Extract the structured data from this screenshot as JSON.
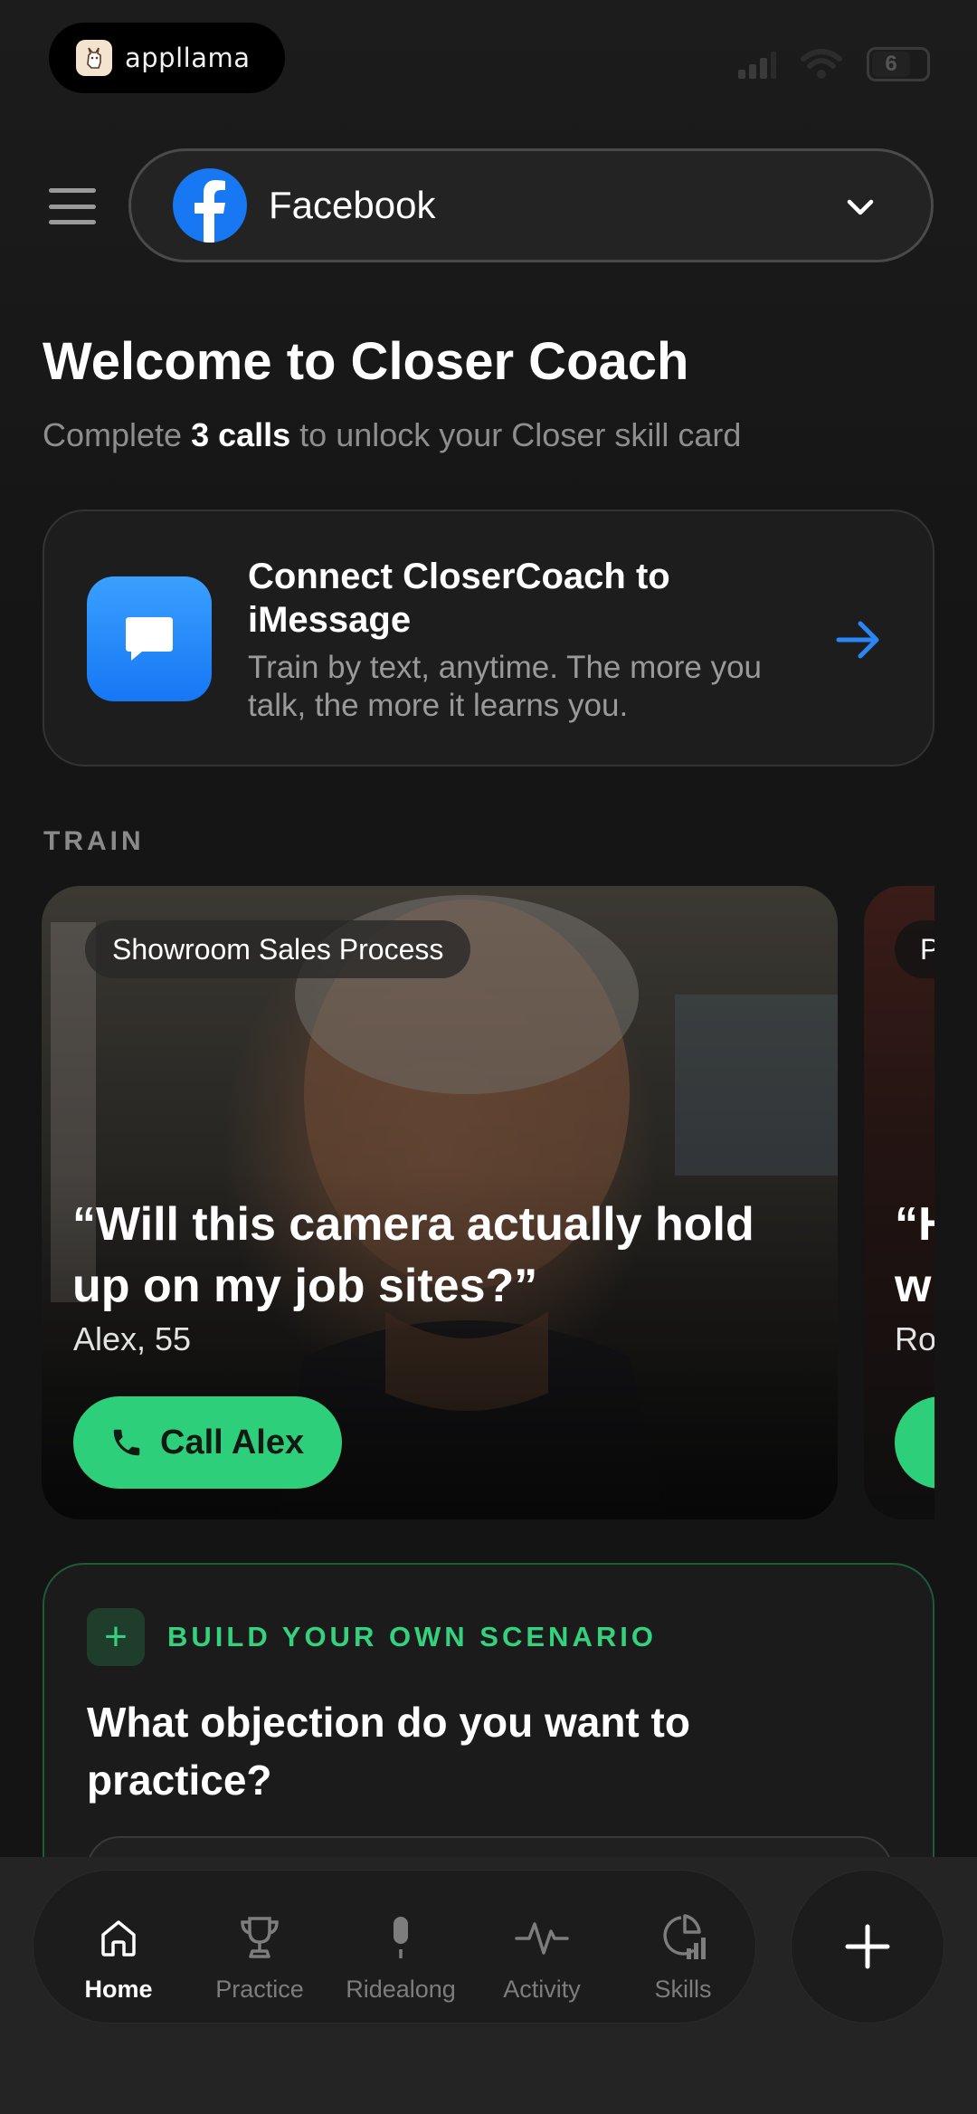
{
  "status_bar": {
    "app_name": "appllama",
    "battery_text": "6"
  },
  "header": {
    "account_name": "Facebook"
  },
  "welcome": {
    "title": "Welcome to Closer Coach",
    "sub_prefix": "Complete ",
    "sub_bold": "3 calls",
    "sub_suffix": " to unlock your Closer skill card"
  },
  "connect_card": {
    "title": "Connect CloserCoach to iMessage",
    "description": "Train by text, anytime. The more you talk, the more it learns you."
  },
  "train": {
    "section_label": "TRAIN",
    "cards": [
      {
        "tag": "Showroom Sales Process",
        "quote": "“Will this camera actually hold up on my job sites?”",
        "persona": "Alex, 55",
        "call_label": "Call Alex"
      },
      {
        "tag": "P",
        "quote_line1": "“H",
        "quote_line2": "w",
        "persona": "Ro"
      }
    ]
  },
  "build": {
    "label": "BUILD YOUR OWN SCENARIO",
    "question": "What objection do you want to practice?"
  },
  "nav": {
    "items": [
      {
        "label": "Home",
        "icon": "home-icon"
      },
      {
        "label": "Practice",
        "icon": "trophy-icon"
      },
      {
        "label": "Ridealong",
        "icon": "microphone-icon"
      },
      {
        "label": "Activity",
        "icon": "pulse-icon"
      },
      {
        "label": "Skills",
        "icon": "chart-icon"
      }
    ]
  },
  "colors": {
    "accent_green": "#2ecf7a",
    "facebook_blue": "#1877f2",
    "imessage_blue": "#1677f5",
    "background": "#161616"
  }
}
